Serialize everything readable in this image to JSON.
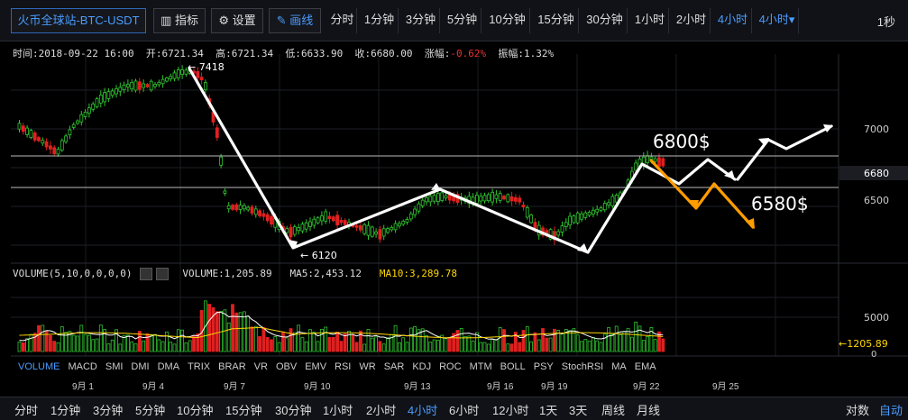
{
  "toolbar": {
    "pair": "火币全球站-BTC-USDT",
    "indicator": "指标",
    "settings": "设置",
    "draw": "画线",
    "periods": [
      "分时",
      "1分钟",
      "3分钟",
      "5分钟",
      "10分钟",
      "15分钟",
      "30分钟",
      "1小时",
      "2小时",
      "4小时",
      "4小时▾"
    ],
    "active_period": "4小时",
    "right_label": "1秒"
  },
  "info": {
    "time_label": "时间:",
    "time": "2018-09-22 16:00",
    "open_label": "开:",
    "open": "6721.34",
    "high_label": "高:",
    "high": "6721.34",
    "low_label": "低:",
    "low": "6633.90",
    "close_label": "收:",
    "close": "6680.00",
    "change_label": "涨幅:",
    "change": "-0.62%",
    "amp_label": "振幅:",
    "amp": "1.32%"
  },
  "chart_data": {
    "type": "candlestick",
    "price_axis": [
      7000,
      6680,
      6500
    ],
    "current_price": "6680",
    "annotations": [
      "7418",
      "6120",
      "6800$",
      "6580$"
    ],
    "x_labels": [
      "9月 1",
      "9月 4",
      "9月 7",
      "9月 10",
      "9月 13",
      "9月 16",
      "9月 19",
      "9月 22",
      "9月 25"
    ],
    "volume_axis": [
      5000,
      0
    ],
    "current_volume": "1205.89",
    "horizontal_lines": [
      6800,
      6580
    ]
  },
  "volume": {
    "label": "VOLUME(5,10,0,0,0,0)",
    "value": "VOLUME:1,205.89",
    "ma5": "MA5:2,453.12",
    "ma10": "MA10:3,289.78"
  },
  "indicators": [
    "VOLUME",
    "MACD",
    "SMI",
    "DMI",
    "DMA",
    "TRIX",
    "BRAR",
    "VR",
    "OBV",
    "EMV",
    "RSI",
    "WR",
    "SAR",
    "KDJ",
    "ROC",
    "MTM",
    "BOLL",
    "PSY",
    "StochRSI",
    "MA",
    "EMA"
  ],
  "active_indicator": "VOLUME",
  "bottom": {
    "periods": [
      "分时",
      "1分钟",
      "3分钟",
      "5分钟",
      "10分钟",
      "15分钟",
      "30分钟",
      "1小时",
      "2小时",
      "4小时",
      "6小时",
      "12小时",
      "1天",
      "3天",
      "周线",
      "月线"
    ],
    "active": "4小时",
    "log_label": "对数",
    "auto_label": "自动"
  },
  "colors": {
    "up": "#2fc52f",
    "down": "#e02020",
    "accent": "#4a9cff",
    "orange": "#ff9c00",
    "yellow": "#ffd800"
  }
}
